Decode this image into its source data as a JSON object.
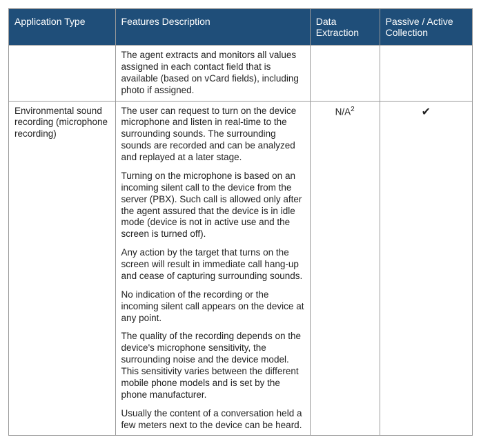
{
  "headers": {
    "col1": "Application Type",
    "col2": "Features Description",
    "col3": "Data Extraction",
    "col4": "Passive / Active Collection"
  },
  "rows": [
    {
      "app_type": "",
      "features": [
        "The agent extracts and monitors all values assigned in each contact field that is available (based on vCard fields), including photo if assigned."
      ],
      "data_extraction": "",
      "collection": ""
    },
    {
      "app_type": "Environmental sound recording (microphone recording)",
      "features": [
        "The user can request to turn on the device microphone and listen in real-time to the surrounding sounds. The surrounding sounds are recorded and can be analyzed and replayed at a later stage.",
        "Turning on the microphone is based on an incoming silent call to the device from the server (PBX). Such call is allowed only after the agent assured that the device is in idle mode (device is not in active use and the screen is turned off).",
        "Any action by the target that turns on the screen will result in immediate call hang-up and cease of capturing surrounding sounds.",
        "No indication of the recording or the incoming silent call appears on the device at any point.",
        "The quality of the recording depends on the device's microphone sensitivity, the surrounding noise and the device model. This sensitivity varies between the different mobile phone models and is set by the phone manufacturer.",
        "Usually the content of a conversation held a few meters next to the device can be heard."
      ],
      "data_extraction": "N/A",
      "data_extraction_sup": "2",
      "collection": "✔"
    }
  ]
}
